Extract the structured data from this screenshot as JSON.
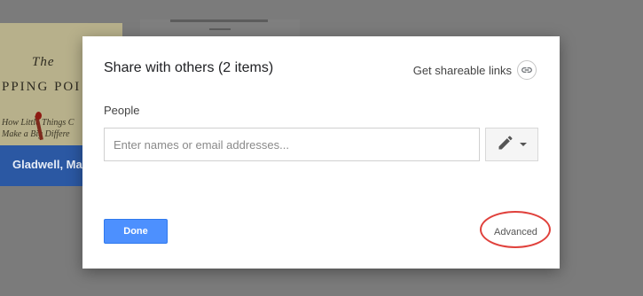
{
  "background": {
    "book": {
      "title_line1": "The",
      "title_line2": "PPING POI",
      "subtitle_line1": "How Little Things C",
      "subtitle_line2": "Make a Big Differe",
      "author": "Gladwell, Mal"
    }
  },
  "dialog": {
    "title": "Share with others (2 items)",
    "get_link_label": "Get shareable links",
    "get_link_icon": "link-icon",
    "people_label": "People",
    "people_placeholder": "Enter names or email addresses...",
    "permission_icon": "pencil-icon",
    "done_label": "Done",
    "advanced_label": "Advanced"
  },
  "colors": {
    "primary_button": "#4d90fe",
    "annotation": "#e0413c",
    "overlay": "#7b7b7b"
  }
}
